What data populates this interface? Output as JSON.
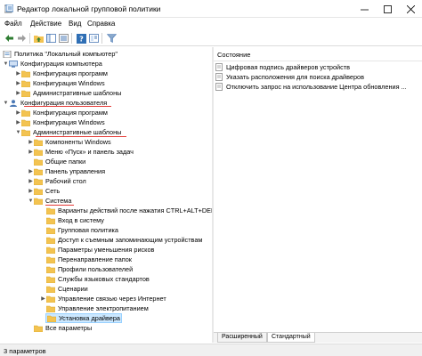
{
  "window": {
    "title": "Редактор локальной групповой политики"
  },
  "menu": {
    "file": "Файл",
    "action": "Действие",
    "view": "Вид",
    "help": "Справка"
  },
  "tree": {
    "root": "Политика \"Локальный компьютер\"",
    "computer_config": "Конфигурация компьютера",
    "cc_programs": "Конфигурация программ",
    "cc_windows": "Конфигурация Windows",
    "cc_admin": "Административные шаблоны",
    "user_config": "Конфигурация пользователя",
    "uc_programs": "Конфигурация программ",
    "uc_windows": "Конфигурация Windows",
    "uc_admin": "Административные шаблоны",
    "win_components": "Компоненты Windows",
    "start_menu": "Меню «Пуск» и панель задач",
    "shared_folders": "Общие папки",
    "control_panel": "Панель управления",
    "desktop": "Рабочий стол",
    "network": "Сеть",
    "system": "Система",
    "ctrl_alt_del": "Варианты действий после нажатия CTRL+ALT+DEL",
    "logon": "Вход в систему",
    "group_policy": "Групповая политика",
    "removable_access": "Доступ к съемным запоминающим устройствам",
    "risk_reduction": "Параметры уменьшения рисков",
    "folder_redirection": "Перенаправление папок",
    "user_profiles": "Профили пользователей",
    "locale_services": "Службы языковых стандартов",
    "scripts": "Сценарии",
    "internet_comm": "Управление связью через Интернет",
    "power_management": "Управление электропитанием",
    "driver_install": "Установка драйвера",
    "all_settings": "Все параметры"
  },
  "details": {
    "column_header": "Состояние",
    "settings": [
      "Цифровая подпись драйверов устройств",
      "Указать расположения для поиска драйверов",
      "Отключить запрос на использование Центра обновления ..."
    ]
  },
  "tabs": {
    "extended": "Расширенный",
    "standard": "Стандартный"
  },
  "status": {
    "text": "3 параметров"
  },
  "colors": {
    "selection": "#cce8ff",
    "folder": "#f3c351",
    "underline": "#e53935"
  }
}
